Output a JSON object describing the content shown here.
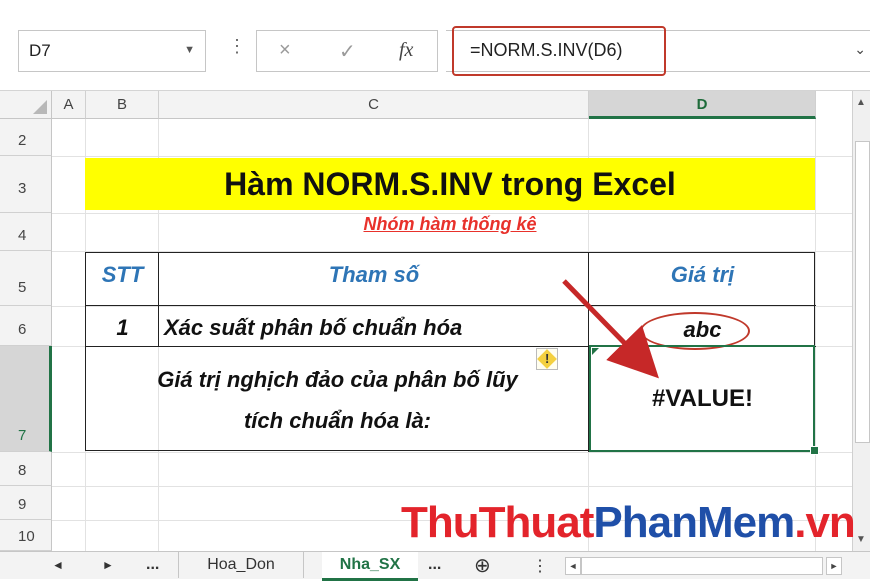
{
  "formula_bar": {
    "name_box": "D7",
    "cancel_icon": "×",
    "enter_icon": "✓",
    "fx_label": "fx",
    "formula": "=NORM.S.INV(D6)"
  },
  "columns": [
    "A",
    "B",
    "C",
    "D"
  ],
  "rows": [
    "2",
    "3",
    "4",
    "5",
    "6",
    "7",
    "8",
    "9",
    "10"
  ],
  "sheet": {
    "title": "Hàm NORM.S.INV trong Excel",
    "subtitle": "Nhóm hàm thống kê",
    "table": {
      "headers": {
        "stt": "STT",
        "param": "Tham số",
        "value": "Giá trị"
      },
      "row1": {
        "stt": "1",
        "param": "Xác suất phân bố chuẩn hóa",
        "value": "abc"
      },
      "result": {
        "label_line1": "Giá trị nghịch đảo của phân bố lũy",
        "label_line2": "tích chuẩn hóa là:",
        "value": "#VALUE!"
      }
    }
  },
  "tabs": {
    "prev_icon": "◄",
    "next_icon": "►",
    "more_left": "...",
    "sheet1": "Hoa_Don",
    "sheet2": "Nha_SX",
    "more_right": "...",
    "add_icon": "⊕"
  },
  "watermark": {
    "part1": "ThuThuat",
    "part2": "PhanMem",
    "part3": ".vn"
  },
  "colors": {
    "accent": "#217346",
    "title_bg": "#ffff00",
    "header_blue": "#2e75b6",
    "subtitle_red": "#e8312b",
    "highlight_red": "#c0392b"
  }
}
